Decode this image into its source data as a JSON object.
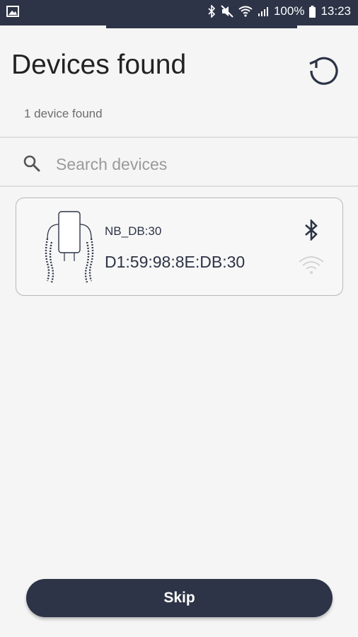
{
  "status_bar": {
    "battery": "100%",
    "time": "13:23"
  },
  "header": {
    "title": "Devices found",
    "refresh_icon": "refresh-icon"
  },
  "results": {
    "count_text": "1 device found"
  },
  "search": {
    "placeholder": "Search devices",
    "icon": "search-icon"
  },
  "devices": [
    {
      "name": "NB_DB:30",
      "mac": "D1:59:98:8E:DB:30",
      "image": "device-icon",
      "bluetooth_icon": "bluetooth-icon",
      "wifi_icon": "wifi-icon"
    }
  ],
  "footer": {
    "skip_label": "Skip"
  },
  "colors": {
    "primary": "#2d3447",
    "background": "#f5f5f5",
    "card_border": "#b6b8bd"
  }
}
